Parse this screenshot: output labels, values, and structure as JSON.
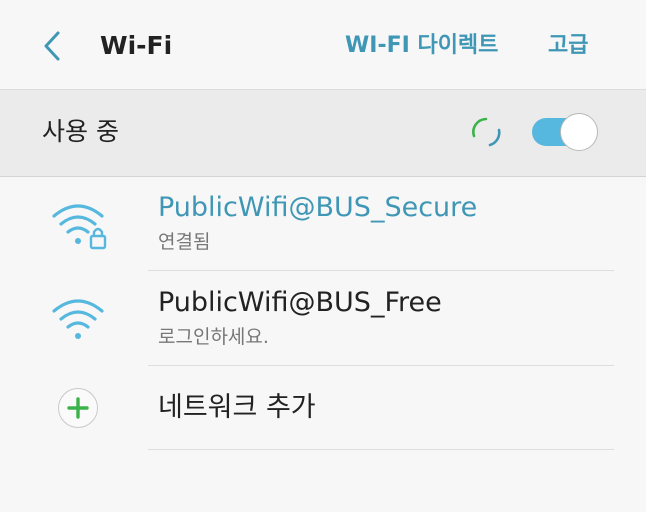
{
  "header": {
    "title": "Wi-Fi",
    "direct_label": "WI-FI 다이렉트",
    "advanced_label": "고급",
    "back_icon": "chevron-left-icon"
  },
  "inuse": {
    "label": "사용 중",
    "toggle_on": true,
    "accent_color": "#56b8de"
  },
  "networks": [
    {
      "name": "PublicWifi@BUS_Secure",
      "status": "연결됨",
      "secured": true,
      "connected": true,
      "icon": "wifi-lock-icon"
    },
    {
      "name": "PublicWifi@BUS_Free",
      "status": "로그인하세요.",
      "secured": false,
      "connected": false,
      "icon": "wifi-icon"
    }
  ],
  "add_network": {
    "label": "네트워크 추가",
    "icon": "plus-icon"
  }
}
